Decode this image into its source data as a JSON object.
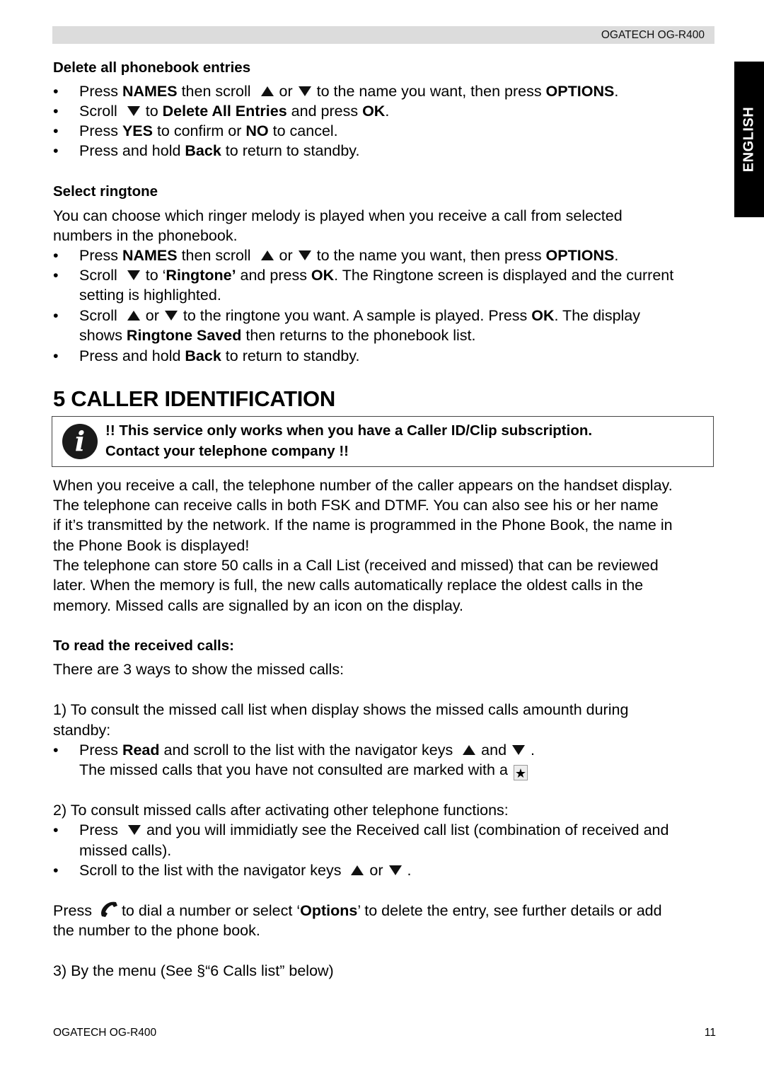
{
  "header": {
    "model": "OGATECH OG-R400"
  },
  "language_tab": "ENGLISH",
  "delete_section": {
    "title": "Delete all phonebook entries",
    "bullets": [
      {
        "parts": [
          "Press ",
          "NAMES",
          " then scroll ",
          "or",
          "to the name you want, then press ",
          "OPTIONS",
          "."
        ]
      },
      {
        "parts": [
          "Scroll ",
          "to ",
          "Delete All Entries",
          " and press ",
          "OK",
          "."
        ]
      },
      {
        "parts": [
          "Press ",
          "YES",
          " to confirm or ",
          "NO",
          " to cancel."
        ]
      },
      {
        "parts": [
          "Press and hold ",
          "Back",
          " to return to standby."
        ]
      }
    ]
  },
  "ringtone_section": {
    "title": "Select ringtone",
    "intro_line1": "You can choose which ringer melody is played when you receive a call from selected",
    "intro_line2": "numbers in the phonebook.",
    "bullets": [
      {
        "parts": [
          "Press ",
          "NAMES",
          " then scroll ",
          "or",
          "to the name you want, then press ",
          "OPTIONS",
          "."
        ]
      },
      {
        "parts": [
          "Scroll ",
          "to ‘",
          "Ringtone’",
          " and press ",
          "OK",
          ". The Ringtone screen is displayed and the current"
        ],
        "cont": "setting is highlighted."
      },
      {
        "parts": [
          "Scroll ",
          "or",
          "to the ringtone you want. A sample is played. Press ",
          "OK",
          ". The display"
        ],
        "cont_parts": [
          "shows ",
          "Ringtone Saved",
          " then returns to the phonebook list."
        ]
      },
      {
        "parts": [
          "Press and hold ",
          "Back",
          " to return to standby."
        ]
      }
    ]
  },
  "caller_id": {
    "section_title": "5  CALLER IDENTIFICATION",
    "note_line1": "!! This service only works when you have a Caller ID/Clip subscription.",
    "note_line2": "Contact your telephone company !!",
    "paragraph_lines": [
      "When you receive a call, the telephone number of the caller appears on the handset display.",
      "The telephone can receive calls in both FSK and DTMF. You can also see his or her name",
      "if it’s transmitted by the network. If the name is programmed in the Phone Book, the name in",
      "the Phone Book is displayed!",
      "The telephone can store 50 calls in a Call List (received and missed) that can be reviewed",
      "later. When the memory is full, the new calls automatically replace the oldest calls in the",
      "memory. Missed calls are signalled by an icon on the display."
    ],
    "read_title": "To read the received calls:",
    "ways_intro": "There are 3 ways to show the missed calls:",
    "way1_line1": "1) To consult the missed call list when display shows the missed calls amounth during",
    "way1_line2": "standby:",
    "way1_bullet": {
      "parts": [
        "Press ",
        "Read",
        " and scroll to the list with the navigator keys ",
        "and",
        "."
      ]
    },
    "way1_cont": "The missed calls that you have not consulted are marked with a",
    "way2_line": "2) To consult missed calls after activating other telephone functions:",
    "way2_bullet1": {
      "parts": [
        "Press ",
        "and you will immidiatly see the Received call list (combination of received and"
      ],
      "cont": "missed calls)."
    },
    "way2_bullet2": {
      "parts": [
        "Scroll to the list with the navigator keys ",
        "or",
        "."
      ]
    },
    "press_line1_parts": [
      "Press ",
      "to dial a number or select ‘",
      "Options",
      "’ to delete the entry, see further details or add"
    ],
    "press_line2": "the number to the phone book.",
    "way3_line": "3) By the menu (See §“6 Calls list” below)"
  },
  "footer": {
    "model": "OGATECH OG-R400",
    "page_number": "11"
  },
  "bullet_char": "•"
}
